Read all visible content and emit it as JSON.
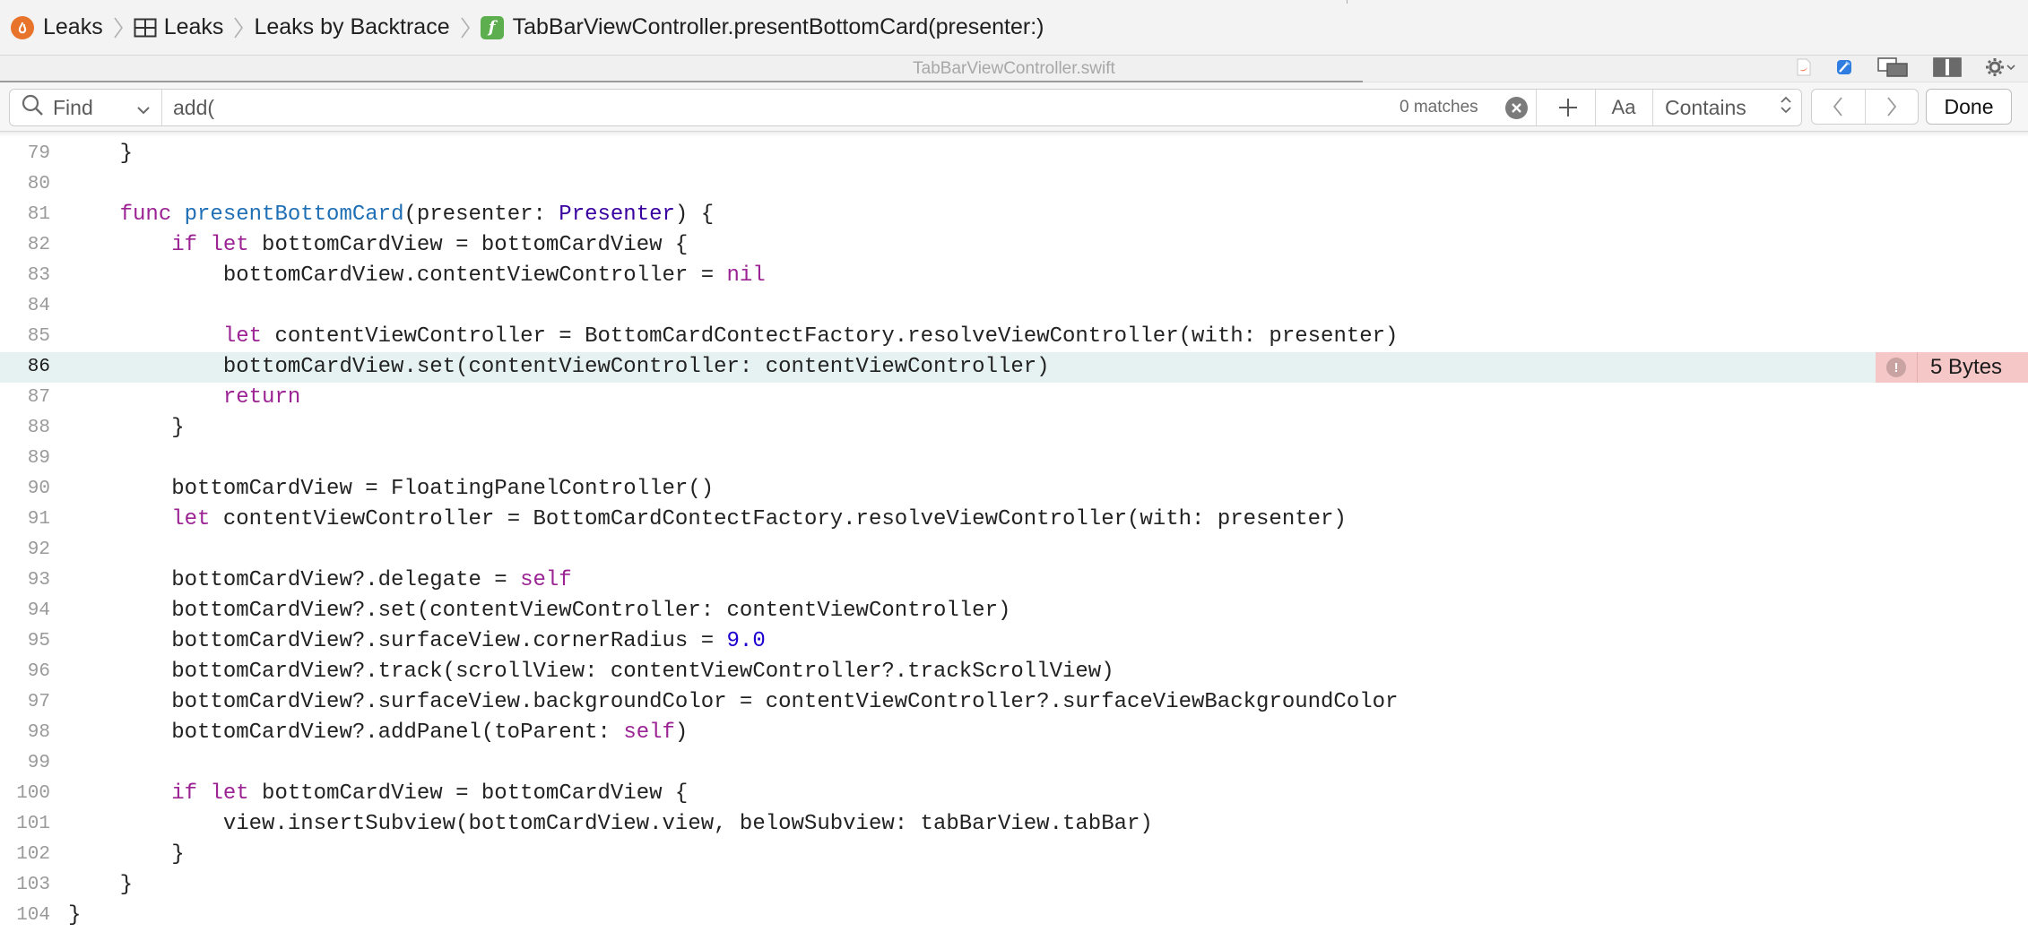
{
  "breadcrumb": {
    "items": [
      {
        "label": "Leaks",
        "icon": "leaks-app-icon"
      },
      {
        "label": "Leaks",
        "icon": "grid-icon"
      },
      {
        "label": "Leaks by Backtrace",
        "icon": ""
      },
      {
        "label": "TabBarViewController.presentBottomCard(presenter:)",
        "icon": "function-icon"
      }
    ]
  },
  "file": {
    "name": "TabBarViewController.swift"
  },
  "find": {
    "mode": "Find",
    "query": "add(",
    "matches": "0 matches",
    "case_label": "Aa",
    "match_type": "Contains",
    "done_label": "Done"
  },
  "code": {
    "highlighted_line": 86,
    "leak_annotation": {
      "line": 86,
      "label": "5 Bytes"
    },
    "lines": [
      {
        "n": "79",
        "text": "    }"
      },
      {
        "n": "80",
        "text": ""
      },
      {
        "n": "81",
        "text": "    func presentBottomCard(presenter: Presenter) {"
      },
      {
        "n": "82",
        "text": "        if let bottomCardView = bottomCardView {"
      },
      {
        "n": "83",
        "text": "            bottomCardView.contentViewController = nil"
      },
      {
        "n": "84",
        "text": ""
      },
      {
        "n": "85",
        "text": "            let contentViewController = BottomCardContectFactory.resolveViewController(with: presenter)"
      },
      {
        "n": "86",
        "text": "            bottomCardView.set(contentViewController: contentViewController)"
      },
      {
        "n": "87",
        "text": "            return"
      },
      {
        "n": "88",
        "text": "        }"
      },
      {
        "n": "89",
        "text": ""
      },
      {
        "n": "90",
        "text": "        bottomCardView = FloatingPanelController()"
      },
      {
        "n": "91",
        "text": "        let contentViewController = BottomCardContectFactory.resolveViewController(with: presenter)"
      },
      {
        "n": "92",
        "text": ""
      },
      {
        "n": "93",
        "text": "        bottomCardView?.delegate = self"
      },
      {
        "n": "94",
        "text": "        bottomCardView?.set(contentViewController: contentViewController)"
      },
      {
        "n": "95",
        "text": "        bottomCardView?.surfaceView.cornerRadius = 9.0"
      },
      {
        "n": "96",
        "text": "        bottomCardView?.track(scrollView: contentViewController?.trackScrollView)"
      },
      {
        "n": "97",
        "text": "        bottomCardView?.surfaceView.backgroundColor = contentViewController?.surfaceViewBackgroundColor"
      },
      {
        "n": "98",
        "text": "        bottomCardView?.addPanel(toParent: self)"
      },
      {
        "n": "99",
        "text": ""
      },
      {
        "n": "100",
        "text": "        if let bottomCardView = bottomCardView {"
      },
      {
        "n": "101",
        "text": "            view.insertSubview(bottomCardView.view, belowSubview: tabBarView.tabBar)"
      },
      {
        "n": "102",
        "text": "        }"
      },
      {
        "n": "103",
        "text": "    }"
      },
      {
        "n": "104",
        "text": "}"
      }
    ]
  },
  "colors": {
    "keyword": "#9b2393",
    "type": "#3900a0",
    "function_name": "#1f6fb5",
    "number": "#1c00cf",
    "highlight_row": "#e6f2f2",
    "leak_badge": "#f6c7c7"
  }
}
